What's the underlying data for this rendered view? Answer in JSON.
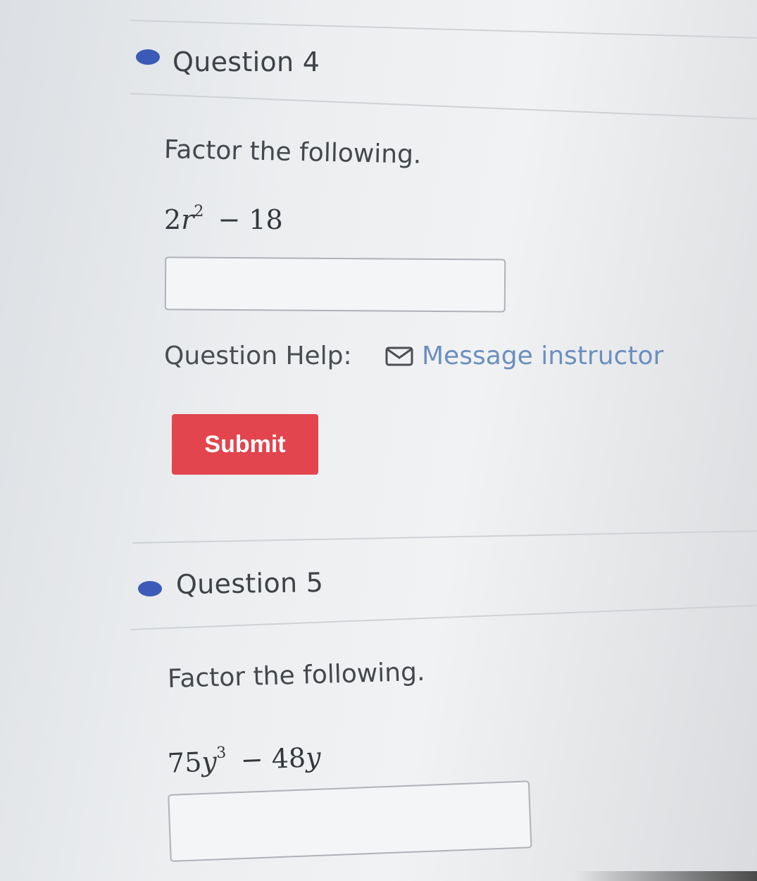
{
  "question4": {
    "title": "Question 4",
    "prompt": "Factor the following.",
    "expression": {
      "coefficient": "2",
      "variable": "r",
      "exponent": "2",
      "rest": "− 18"
    },
    "answer_value": ""
  },
  "question_help": {
    "label": "Question Help:",
    "link_label": "Message instructor",
    "link_icon": "mail-icon"
  },
  "submit": {
    "label": "Submit",
    "color": "#e2454d"
  },
  "question5": {
    "title": "Question 5",
    "prompt": "Factor the following.",
    "expression": {
      "coefficient": "75",
      "variable": "y",
      "exponent": "3",
      "rest_number": "− 48",
      "rest_variable": "y"
    },
    "answer_value": ""
  },
  "colors": {
    "accent_dot": "#3c5bb8",
    "link": "#6b8fbf"
  }
}
